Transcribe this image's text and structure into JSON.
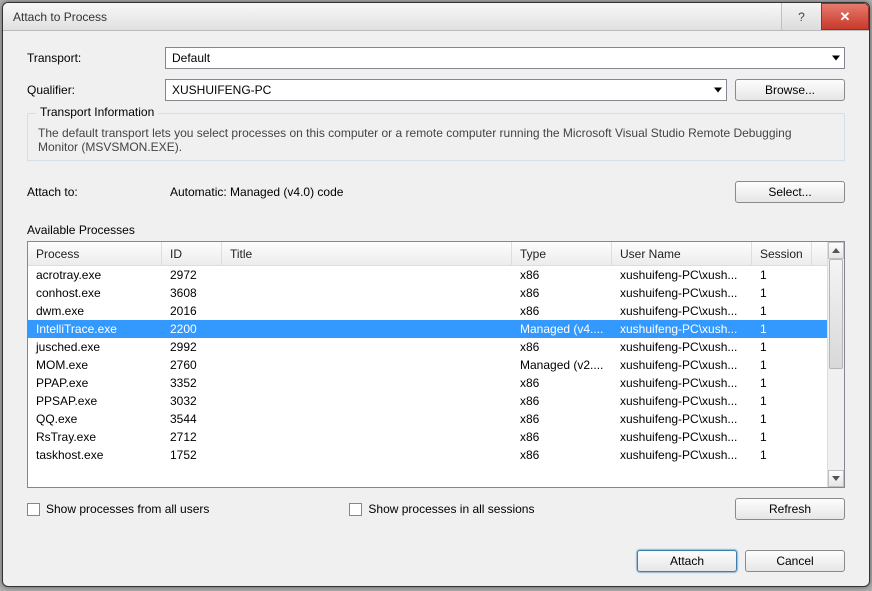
{
  "window": {
    "title": "Attach to Process"
  },
  "labels": {
    "transport": "Transport:",
    "qualifier": "Qualifier:",
    "attach_to": "Attach to:",
    "available_processes": "Available Processes",
    "transport_info_title": "Transport Information"
  },
  "transport": {
    "value": "Default"
  },
  "qualifier": {
    "value": "XUSHUIFENG-PC"
  },
  "transport_info": {
    "text": "The default transport lets you select processes on this computer or a remote computer running the Microsoft Visual Studio Remote Debugging Monitor (MSVSMON.EXE)."
  },
  "attach_to": {
    "value": "Automatic: Managed (v4.0) code"
  },
  "buttons": {
    "browse": "Browse...",
    "select": "Select...",
    "refresh": "Refresh",
    "attach": "Attach",
    "cancel": "Cancel"
  },
  "checkboxes": {
    "all_users": "Show processes from all users",
    "all_sessions": "Show processes in all sessions"
  },
  "columns": {
    "process": "Process",
    "id": "ID",
    "title": "Title",
    "type": "Type",
    "user": "User Name",
    "session": "Session"
  },
  "processes": [
    {
      "name": "acrotray.exe",
      "id": "2972",
      "title": "",
      "type": "x86",
      "user": "xushuifeng-PC\\xush...",
      "session": "1",
      "selected": false
    },
    {
      "name": "conhost.exe",
      "id": "3608",
      "title": "",
      "type": "x86",
      "user": "xushuifeng-PC\\xush...",
      "session": "1",
      "selected": false
    },
    {
      "name": "dwm.exe",
      "id": "2016",
      "title": "",
      "type": "x86",
      "user": "xushuifeng-PC\\xush...",
      "session": "1",
      "selected": false
    },
    {
      "name": "IntelliTrace.exe",
      "id": "2200",
      "title": "",
      "type": "Managed (v4....",
      "user": "xushuifeng-PC\\xush...",
      "session": "1",
      "selected": true
    },
    {
      "name": "jusched.exe",
      "id": "2992",
      "title": "",
      "type": "x86",
      "user": "xushuifeng-PC\\xush...",
      "session": "1",
      "selected": false
    },
    {
      "name": "MOM.exe",
      "id": "2760",
      "title": "",
      "type": "Managed (v2....",
      "user": "xushuifeng-PC\\xush...",
      "session": "1",
      "selected": false
    },
    {
      "name": "PPAP.exe",
      "id": "3352",
      "title": "",
      "type": "x86",
      "user": "xushuifeng-PC\\xush...",
      "session": "1",
      "selected": false
    },
    {
      "name": "PPSAP.exe",
      "id": "3032",
      "title": "",
      "type": "x86",
      "user": "xushuifeng-PC\\xush...",
      "session": "1",
      "selected": false
    },
    {
      "name": "QQ.exe",
      "id": "3544",
      "title": "",
      "type": "x86",
      "user": "xushuifeng-PC\\xush...",
      "session": "1",
      "selected": false
    },
    {
      "name": "RsTray.exe",
      "id": "2712",
      "title": "",
      "type": "x86",
      "user": "xushuifeng-PC\\xush...",
      "session": "1",
      "selected": false
    },
    {
      "name": "taskhost.exe",
      "id": "1752",
      "title": "",
      "type": "x86",
      "user": "xushuifeng-PC\\xush...",
      "session": "1",
      "selected": false
    }
  ]
}
